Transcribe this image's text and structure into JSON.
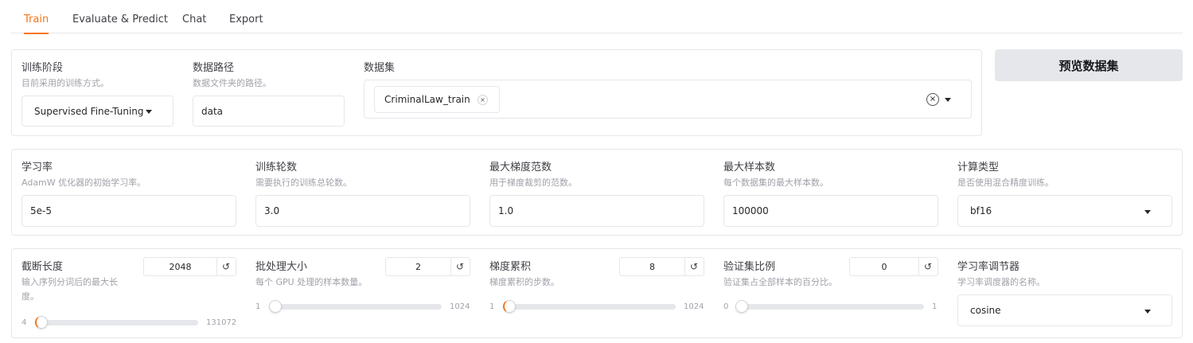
{
  "tabs": [
    {
      "label": "Train",
      "active": true
    },
    {
      "label": "Evaluate & Predict",
      "active": false
    },
    {
      "label": "Chat",
      "active": false
    },
    {
      "label": "Export",
      "active": false
    }
  ],
  "row1": {
    "stage": {
      "label": "训练阶段",
      "info": "目前采用的训练方式。",
      "value": "Supervised Fine-Tuning"
    },
    "data_path": {
      "label": "数据路径",
      "info": "数据文件夹的路径。",
      "value": "data"
    },
    "dataset": {
      "label": "数据集",
      "chip": "CriminalLaw_train"
    },
    "preview_button": "预览数据集"
  },
  "row2": {
    "learning_rate": {
      "label": "学习率",
      "info": "AdamW 优化器的初始学习率。",
      "value": "5e-5"
    },
    "epochs": {
      "label": "训练轮数",
      "info": "需要执行的训练总轮数。",
      "value": "3.0"
    },
    "max_grad_norm": {
      "label": "最大梯度范数",
      "info": "用于梯度裁剪的范数。",
      "value": "1.0"
    },
    "max_samples": {
      "label": "最大样本数",
      "info": "每个数据集的最大样本数。",
      "value": "100000"
    },
    "compute_type": {
      "label": "计算类型",
      "info": "是否使用混合精度训练。",
      "value": "bf16"
    }
  },
  "row3": {
    "cutoff_len": {
      "label": "截断长度",
      "info": "输入序列分词后的最大长度。",
      "value": "2048",
      "min": "4",
      "max": "131072",
      "fraction": 0.0156
    },
    "batch_size": {
      "label": "批处理大小",
      "info": "每个 GPU 处理的样本数量。",
      "value": "2",
      "min": "1",
      "max": "1024",
      "fraction": 0.001
    },
    "grad_accum": {
      "label": "梯度累积",
      "info": "梯度累积的步数。",
      "value": "8",
      "min": "1",
      "max": "1024",
      "fraction": 0.007
    },
    "val_size": {
      "label": "验证集比例",
      "info": "验证集占全部样本的百分比。",
      "value": "0",
      "min": "0",
      "max": "1",
      "fraction": 0.0
    },
    "lr_scheduler": {
      "label": "学习率调节器",
      "info": "学习率调度器的名称。",
      "value": "cosine"
    }
  },
  "icons": {
    "reset": "↺",
    "remove": "×"
  },
  "colors": {
    "accent": "#f97316"
  }
}
